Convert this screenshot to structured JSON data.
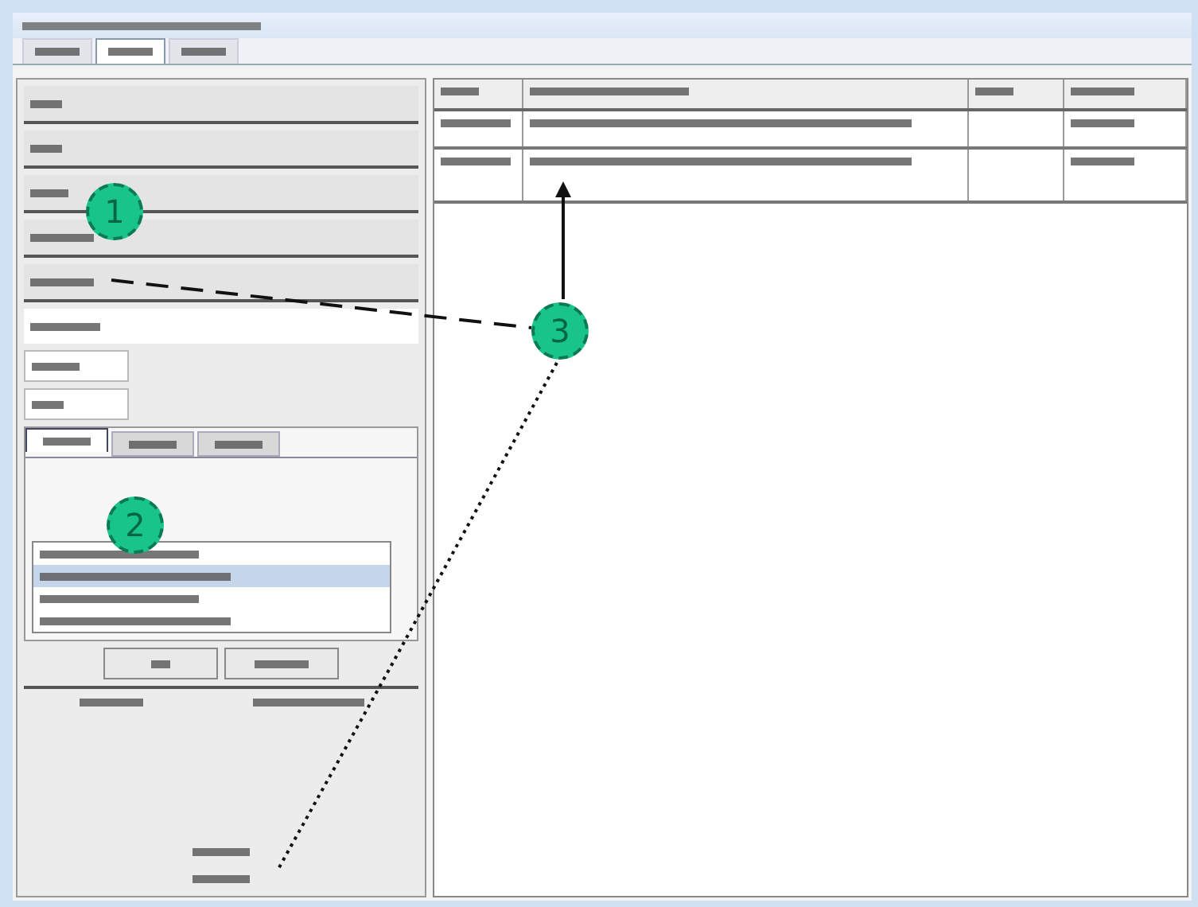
{
  "window_tabs": [
    {
      "selected": false
    },
    {
      "selected": true
    },
    {
      "selected": false
    }
  ],
  "inner_tabs": [
    {
      "selected": true
    },
    {
      "selected": false
    },
    {
      "selected": false
    }
  ],
  "list": {
    "items": [
      {
        "selected": false
      },
      {
        "selected": true
      },
      {
        "selected": false
      },
      {
        "selected": false
      }
    ]
  },
  "table": {
    "rows": [
      {
        "selected": false
      },
      {
        "selected": false
      }
    ]
  },
  "callouts": [
    {
      "number": "1"
    },
    {
      "number": "2"
    },
    {
      "number": "3"
    }
  ]
}
